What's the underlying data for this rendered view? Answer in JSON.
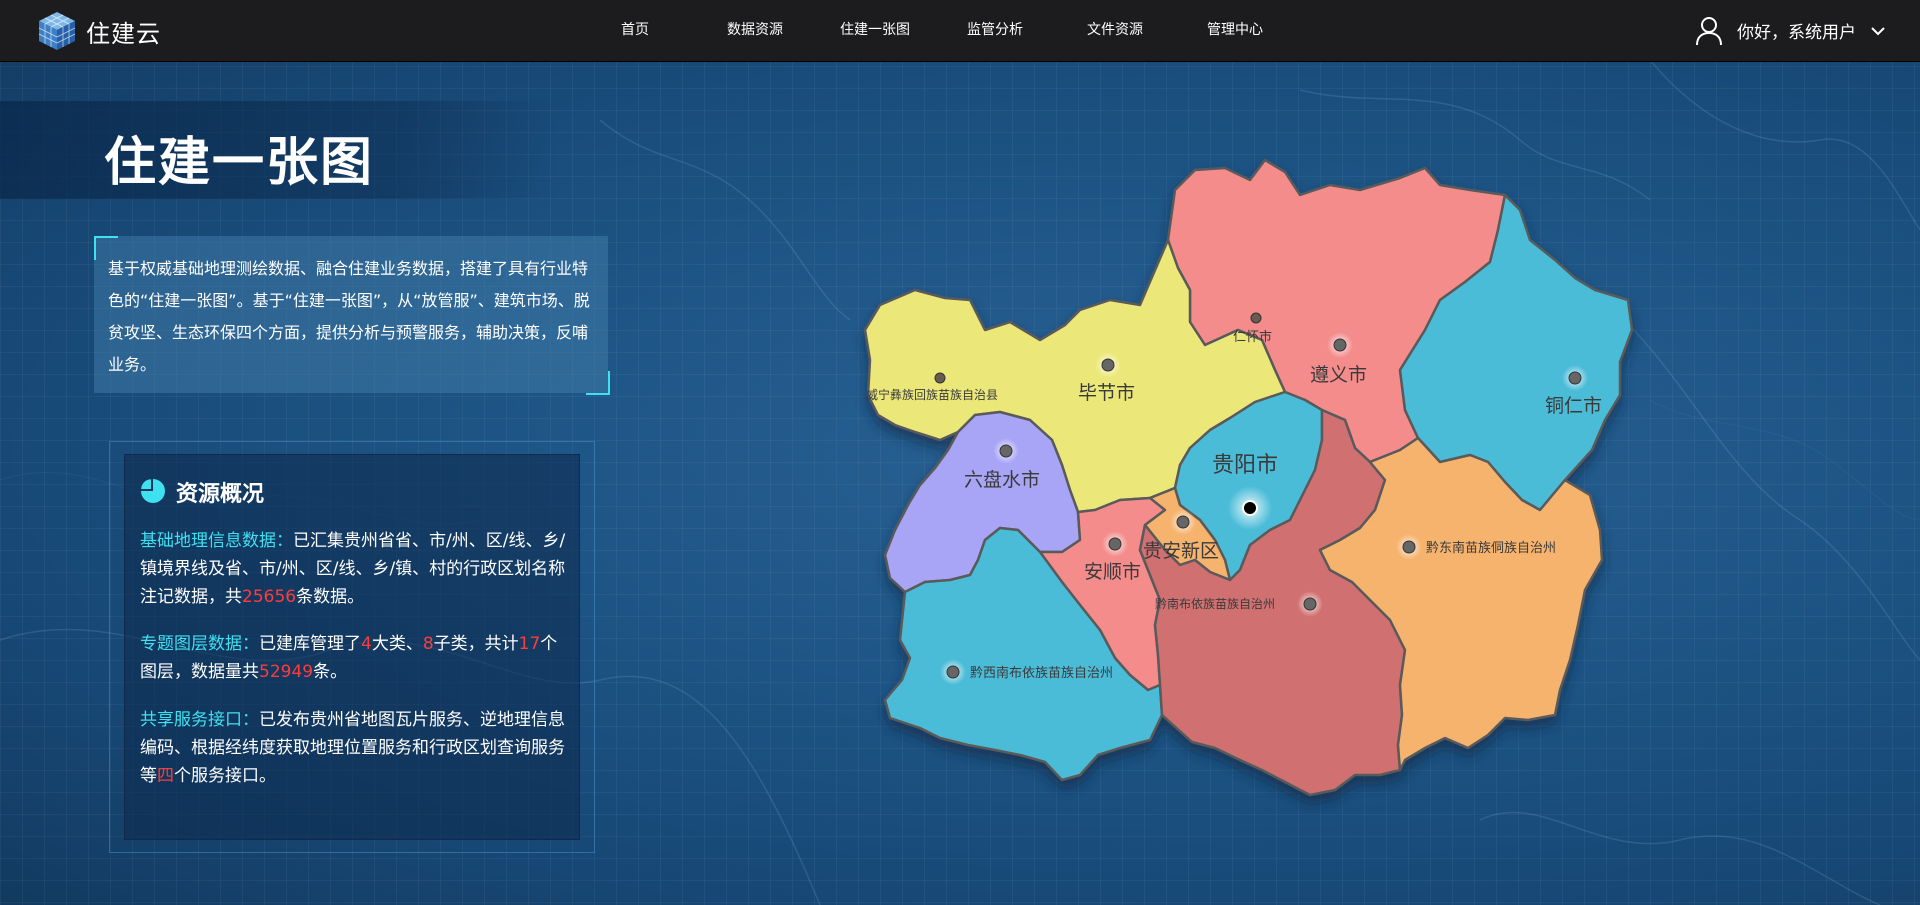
{
  "header": {
    "brand": "住建云",
    "nav": [
      "首页",
      "数据资源",
      "住建一张图",
      "监管分析",
      "文件资源",
      "管理中心"
    ],
    "user_greeting": "你好，系统用户"
  },
  "page": {
    "title": "住建一张图",
    "intro": "基于权威基础地理测绘数据、融合住建业务数据，搭建了具有行业特色的“住建一张图”。基于“住建一张图”，从“放管服”、建筑市场、脱贫攻坚、生态环保四个方面，提供分析与预警服务，辅助决策，反哺业务。"
  },
  "resources": {
    "title": "资源概况",
    "items": [
      {
        "label": "基础地理信息数据：",
        "text_a": "已汇集贵州省省、市/州、区/线、乡/镇境界线及省、市/州、区/线、乡/镇、村的行政区划名称注记数据，共",
        "num1": "25656",
        "text_b": "条数据。"
      },
      {
        "label": "专题图层数据：",
        "text_a": "已建库管理了",
        "num1": "4",
        "text_b": "大类、",
        "num2": "8",
        "text_c": "子类，共计",
        "num3": "17",
        "text_d": "个图层，数据量共",
        "num4": "52949",
        "text_e": "条。"
      },
      {
        "label": "共享服务接口：",
        "text_a": "已发布贵州省地图瓦片服务、逆地理信息编码、根据经纬度获取地理位置服务和行政区划查询服务等",
        "num1": "四",
        "text_b": "个服务接口。"
      }
    ]
  },
  "map": {
    "regions": [
      {
        "name": "遵义市",
        "color": "#f58c8c"
      },
      {
        "name": "铜仁市",
        "color": "#4bbcd8"
      },
      {
        "name": "毕节市",
        "color": "#ebe879"
      },
      {
        "name": "六盘水市",
        "color": "#a8a4f6"
      },
      {
        "name": "贵阳市",
        "color": "#4bbcd8"
      },
      {
        "name": "贵安新区",
        "color": "#f5b36e"
      },
      {
        "name": "安顺市",
        "color": "#f58c8c"
      },
      {
        "name": "黔南布依族苗族自治州",
        "color": "#d07070"
      },
      {
        "name": "黔东南苗族侗族自治州",
        "color": "#f5b36e"
      },
      {
        "name": "黔西南布依族苗族自治州",
        "color": "#4bbcd8"
      }
    ],
    "small_labels": {
      "renhuai": "仁怀市",
      "weining": "威宁彝族回族苗族自治县"
    }
  }
}
